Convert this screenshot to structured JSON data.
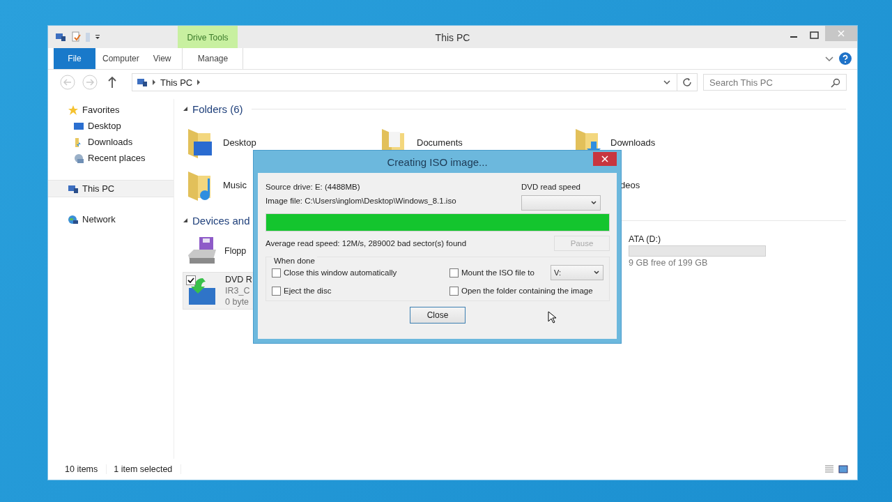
{
  "window": {
    "title": "This PC",
    "context_tab": "Drive Tools"
  },
  "ribbon_tabs": [
    {
      "label": "File",
      "kind": "file",
      "selected": false
    },
    {
      "label": "Computer",
      "kind": "tab",
      "selected": false
    },
    {
      "label": "View",
      "kind": "tab",
      "selected": false
    },
    {
      "label": "Manage",
      "kind": "context",
      "selected": false
    }
  ],
  "address": {
    "crumbs": [
      "This PC"
    ]
  },
  "search": {
    "placeholder": "Search This PC"
  },
  "sidebar": [
    {
      "label": "Favorites",
      "selected": false,
      "children": [
        {
          "label": "Desktop",
          "selected": false
        },
        {
          "label": "Downloads",
          "selected": false
        },
        {
          "label": "Recent places",
          "selected": false
        }
      ]
    },
    {
      "label": "This PC",
      "selected": true
    },
    {
      "label": "Network",
      "selected": false
    }
  ],
  "folders": {
    "heading": "Folders (6)",
    "items": [
      {
        "label": "Desktop"
      },
      {
        "label": "Documents"
      },
      {
        "label": "Downloads"
      },
      {
        "label": "Music"
      },
      {
        "label": "deos"
      }
    ]
  },
  "devices": {
    "heading": "Devices and",
    "items": [
      {
        "lines": [
          "Flopp"
        ],
        "selected": false
      },
      {
        "lines": [
          "ATA (D:)",
          "9 GB free of 199 GB"
        ],
        "selected": false
      },
      {
        "lines": [
          "DVD R",
          "IR3_C",
          "0 byte"
        ],
        "selected": true
      }
    ]
  },
  "status_bar": {
    "count": "10 items",
    "selection": "1 item selected"
  },
  "dialog": {
    "title": "Creating ISO image...",
    "source": "Source drive: E: (4488MB)",
    "image_file": "Image file: C:\\Users\\inglom\\Desktop\\Windows_8.1.iso",
    "speed_label": "DVD read speed",
    "progress": {
      "level": 1.0
    },
    "status": "Average read speed: 12M/s, 289002 bad sector(s) found",
    "pause": {
      "label": "Pause",
      "disabled": true
    },
    "group_label": "When done",
    "options": [
      {
        "label": "Close this window automatically",
        "checked": false
      },
      {
        "label": "Eject the disc",
        "checked": false
      },
      {
        "label": "Mount the ISO file to",
        "checked": false
      },
      {
        "label": "Open the folder containing the image",
        "checked": false
      }
    ],
    "mount_drive": "V:",
    "close_button": "Close"
  }
}
